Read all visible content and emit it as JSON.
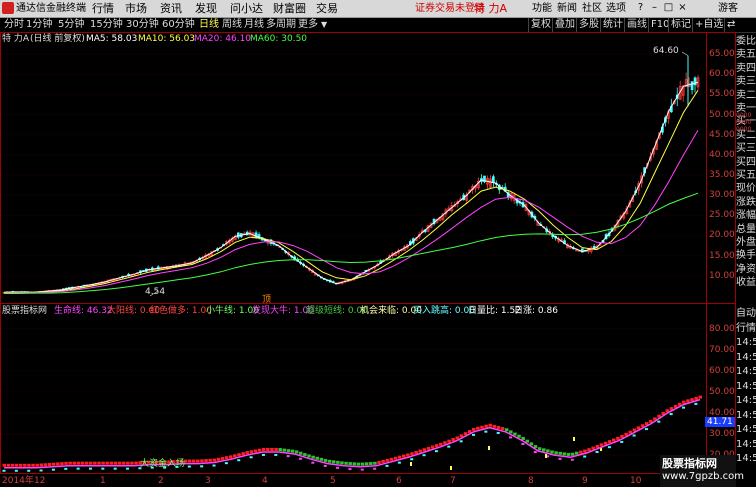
{
  "menubar": {
    "app_title": "通达信金融终端",
    "menus": [
      "行情",
      "市场",
      "资讯",
      "发现",
      "问小达",
      "财富圈",
      "交易"
    ],
    "login_alert": "证券交易未登录",
    "stock_name": "特 力A",
    "right_items": [
      "功能",
      "新闻",
      "社区",
      "选项"
    ],
    "guest": "游客"
  },
  "toolbar": {
    "periods": [
      "分时",
      "1分钟",
      "5分钟",
      "15分钟",
      "30分钟",
      "60分钟",
      "日线",
      "周线",
      "月线",
      "多周期",
      "更多"
    ],
    "active_period": "日线",
    "right_buttons": [
      "复权",
      "叠加",
      "多股",
      "统计",
      "画线",
      "F10",
      "标记",
      "+自选",
      "⇄"
    ]
  },
  "ma_legend": {
    "name": "特 力A",
    "mode": "(日线 前复权)",
    "items": [
      {
        "label": "MA5: 58.03",
        "color": "#ffffff"
      },
      {
        "label": "MA10: 56.03",
        "color": "#ffff44"
      },
      {
        "label": "MA20: 46.10",
        "color": "#ff44ff"
      },
      {
        "label": "MA60: 30.50",
        "color": "#44ff44"
      }
    ]
  },
  "indicator_legend": {
    "name": "股票指标网",
    "items": [
      {
        "label": "生命线: 46.32",
        "color": "#ff44ff"
      },
      {
        "label": "大阳线: 0.00",
        "color": "#ff4444"
      },
      {
        "label": "红色做多: 1.00",
        "color": "#ff4444"
      },
      {
        "label": "小牛线: 1.00",
        "color": "#66ff66"
      },
      {
        "label": "发现大牛: 1.00",
        "color": "#ff44ff"
      },
      {
        "label": "超级短线: 0.00",
        "color": "#44cc44"
      },
      {
        "label": "机会来临: 0.00",
        "color": "#ffffaa"
      },
      {
        "label": "买入跳高: 0.00",
        "color": "#66ffff"
      },
      {
        "label": "日量比: 1.52",
        "color": "#ffffff"
      },
      {
        "label": "日涨: 0.86",
        "color": "#ffffff"
      }
    ]
  },
  "right_panel_labels": [
    "委比",
    "卖五",
    "卖四",
    "卖三",
    "卖二",
    "卖一",
    "买一",
    "买二",
    "买三",
    "买四",
    "买五",
    "现价",
    "涨跌",
    "涨幅",
    "总量",
    "外盘",
    "换手",
    "净资",
    "收益"
  ],
  "right_panel_small": [
    "0000",
    "0000",
    "0000"
  ],
  "right_panel_lower": [
    "自动",
    "行情",
    "14:5",
    "14:5",
    "14:5",
    "14:5",
    "14:5",
    "14:5",
    "14:5",
    "14:5",
    "14:5"
  ],
  "main_yticks": [
    "65.00",
    "60.00",
    "55.00",
    "50.00",
    "45.00",
    "40.00",
    "35.00",
    "30.00",
    "25.00",
    "20.00",
    "15.00",
    "10.00"
  ],
  "sub_yticks": [
    "80.00",
    "70.00",
    "60.00",
    "50.00",
    "40.00",
    "30.00",
    "20.00"
  ],
  "xticks": [
    "2014年",
    "12",
    "1",
    "2",
    "3",
    "4",
    "5",
    "6",
    "7",
    "8",
    "9",
    "10",
    "11"
  ],
  "annotations": {
    "high": "64.60",
    "low": "4.54",
    "ding": "顶",
    "signal": "大资金入场",
    "current": "41.71"
  },
  "watermark": {
    "line1": "股票指标网",
    "line2": "www.7gpzb.com"
  },
  "chart_data": {
    "type": "line",
    "main": {
      "ylim": [
        4,
        67
      ],
      "bar_count": 235,
      "series": [
        {
          "name": "MA5",
          "values": [
            5.9,
            6.0,
            5.9,
            6.2,
            6.5,
            7.2,
            7.8,
            8.5,
            9.5,
            10.4,
            11.5,
            12.0,
            12.5,
            13.2,
            15.0,
            17.0,
            19.8,
            20.5,
            19.0,
            17.5,
            14.5,
            12.0,
            9.5,
            8.0,
            9.0,
            11.0,
            13.0,
            15.5,
            17.5,
            21.0,
            24.0,
            27.0,
            30.0,
            33.8,
            33.0,
            30.0,
            27.5,
            23.0,
            20.0,
            17.5,
            16.0,
            17.0,
            21.0,
            26.0,
            33.0,
            42.0,
            51.0,
            57.0,
            58.0
          ]
        },
        {
          "name": "MA10",
          "values": [
            5.8,
            5.9,
            5.9,
            6.0,
            6.3,
            6.8,
            7.4,
            8.1,
            9.0,
            9.9,
            10.9,
            11.6,
            12.2,
            12.8,
            14.2,
            16.0,
            18.3,
            19.6,
            19.2,
            18.2,
            16.0,
            13.5,
            11.0,
            9.5,
            9.0,
            10.0,
            11.8,
            14.0,
            16.3,
            19.0,
            22.0,
            25.2,
            28.0,
            31.0,
            32.0,
            31.0,
            29.0,
            26.0,
            22.5,
            19.5,
            17.0,
            16.5,
            18.5,
            22.5,
            28.0,
            35.5,
            43.0,
            50.5,
            56.0
          ]
        },
        {
          "name": "MA20",
          "values": [
            5.7,
            5.8,
            5.8,
            5.9,
            6.1,
            6.5,
            7.0,
            7.6,
            8.4,
            9.2,
            10.1,
            10.8,
            11.4,
            12.0,
            13.1,
            14.6,
            16.5,
            17.8,
            18.4,
            18.4,
            17.5,
            16.0,
            14.0,
            12.0,
            10.8,
            10.5,
            11.0,
            12.5,
            14.5,
            16.8,
            19.2,
            21.8,
            24.5,
            27.0,
            29.0,
            29.5,
            28.8,
            27.0,
            24.5,
            22.0,
            19.8,
            18.3,
            18.0,
            19.5,
            22.5,
            27.5,
            33.5,
            40.0,
            46.1
          ]
        },
        {
          "name": "MA60",
          "values": [
            5.6,
            5.6,
            5.7,
            5.7,
            5.8,
            6.0,
            6.3,
            6.6,
            7.0,
            7.5,
            8.0,
            8.5,
            9.0,
            9.5,
            10.2,
            11.0,
            12.0,
            12.8,
            13.4,
            13.8,
            14.0,
            14.0,
            13.8,
            13.5,
            13.3,
            13.4,
            13.7,
            14.2,
            14.9,
            15.6,
            16.3,
            17.0,
            17.8,
            18.7,
            19.5,
            20.0,
            20.3,
            20.4,
            20.3,
            20.2,
            20.3,
            20.8,
            21.6,
            22.8,
            24.3,
            26.0,
            27.8,
            29.2,
            30.5
          ]
        }
      ]
    },
    "sub": {
      "ylim": [
        12,
        85
      ],
      "series": [
        {
          "name": "生命线",
          "values": [
            14,
            14,
            14,
            14.5,
            15,
            15,
            15,
            15,
            15,
            15.5,
            15.5,
            16,
            16,
            16.5,
            18,
            20,
            21.5,
            21.5,
            20.5,
            18,
            16,
            15,
            14.5,
            15,
            17,
            19,
            21.5,
            24,
            27,
            31,
            33,
            31,
            27,
            22,
            20,
            19,
            21,
            24,
            27,
            31,
            35,
            40,
            44,
            46.3
          ]
        }
      ]
    }
  }
}
